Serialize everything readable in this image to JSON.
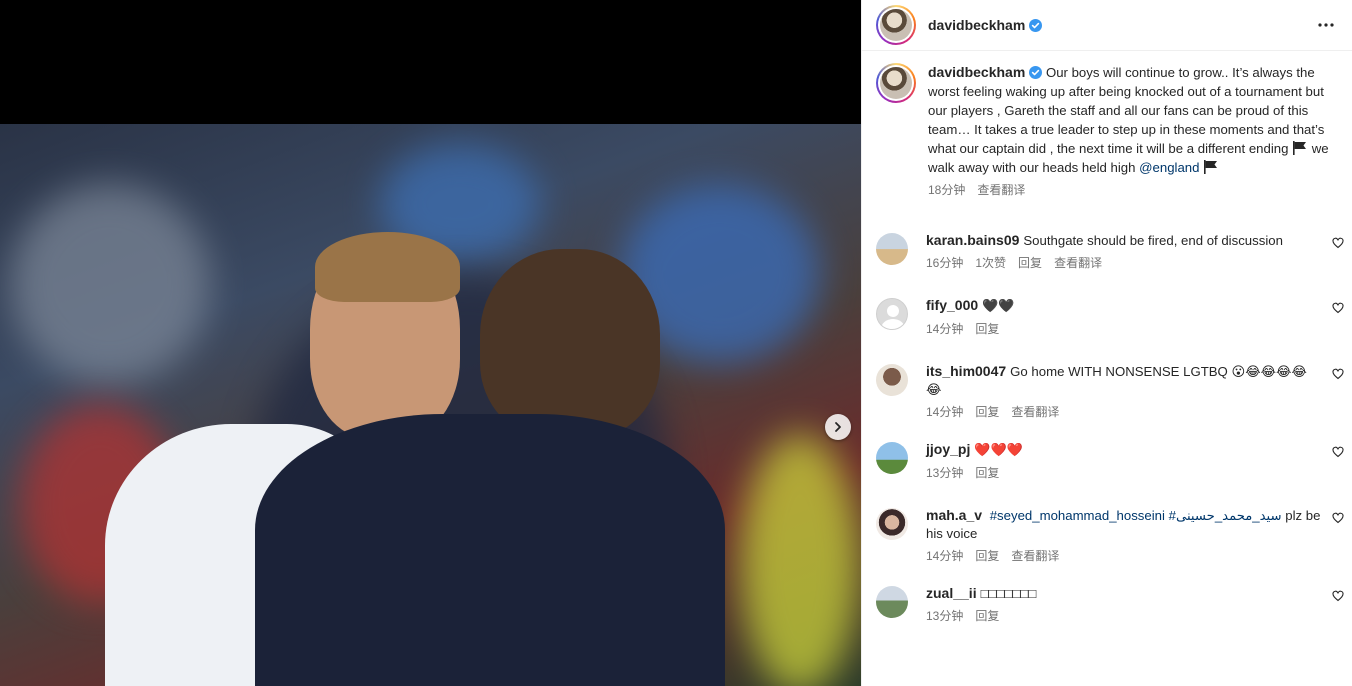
{
  "post": {
    "username": "davidbeckham",
    "caption_text": "Our boys will continue to grow.. It’s always the worst feeling waking up after being knocked out of a tournament but our players , Gareth the staff and all our fans can be proud of this team… It takes a true leader to step up in these moments and that’s what our captain did , the next time it will be a different ending",
    "caption_tail": "we walk away with our heads held high",
    "mention": "@england",
    "time": "18分钟",
    "translate": "查看翻译"
  },
  "comments": [
    {
      "user": "karan.bains09",
      "text": "Southgate should be fired, end of discussion",
      "time": "16分钟",
      "likes": "1次赞",
      "reply": "回复",
      "translate": "查看翻译"
    },
    {
      "user": "fify_000",
      "text": "🖤🖤",
      "time": "14分钟",
      "reply": "回复"
    },
    {
      "user": "its_him0047",
      "text": "Go home WITH NONSENSE LGTBQ 😮😂😂😂😂😂",
      "time": "14分钟",
      "reply": "回复",
      "translate": "查看翻译"
    },
    {
      "user": "jjoy_pj",
      "text": "❤️❤️❤️",
      "time": "13分钟",
      "reply": "回复"
    },
    {
      "user": "mah.a_v",
      "hashtag1": "#seyed_mohammad_hosseini",
      "hashtag2": "#سید_محمد_حسینی",
      "text": "plz be his voice",
      "time": "14分钟",
      "reply": "回复",
      "translate": "查看翻译"
    },
    {
      "user": "zual__ii",
      "text": "□□□□□□□",
      "time": "13分钟",
      "reply": "回复"
    }
  ],
  "icons": {
    "verified_color": "#3897f0",
    "link_color": "#00376b",
    "heart": "heart-outline-icon",
    "more": "more-horizontal-icon",
    "next": "chevron-right-icon"
  }
}
